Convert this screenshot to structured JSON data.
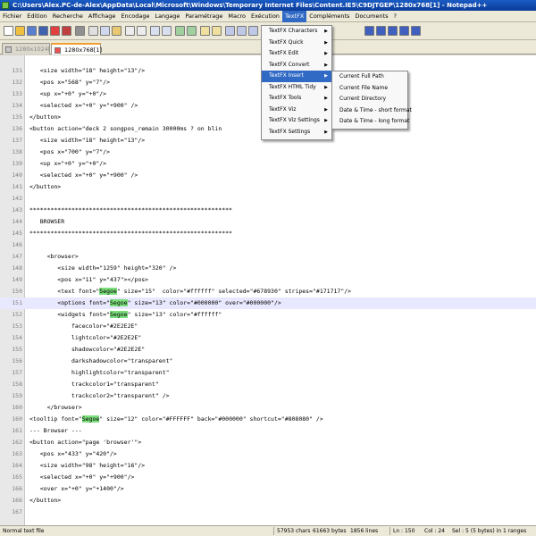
{
  "window": {
    "title": "C:\\Users\\Alex.PC-de-Alex\\AppData\\Local\\Microsoft\\Windows\\Temporary Internet Files\\Content.IE5\\C9DJTGEP\\1280x768[1] - Notepad++"
  },
  "menubar": {
    "items": [
      {
        "label": "Fichier"
      },
      {
        "label": "Edition"
      },
      {
        "label": "Recherche"
      },
      {
        "label": "Affichage"
      },
      {
        "label": "Encodage"
      },
      {
        "label": "Langage"
      },
      {
        "label": "Paramétrage"
      },
      {
        "label": "Macro"
      },
      {
        "label": "Exécution"
      },
      {
        "label": "TextFX"
      },
      {
        "label": "Compléments"
      },
      {
        "label": "Documents"
      },
      {
        "label": "?"
      }
    ]
  },
  "tabs": [
    {
      "label": "1280x1024[1]"
    },
    {
      "label": "1280x768[1]"
    }
  ],
  "editor": {
    "lines": [
      {
        "n": "131",
        "code": "   <size width=\"18\" height=\"13\"/>"
      },
      {
        "n": "132",
        "code": "   <pos x=\"568\" y=\"7\"/>"
      },
      {
        "n": "133",
        "code": "   <up x=\"+0\" y=\"+0\"/>"
      },
      {
        "n": "134",
        "code": "   <selected x=\"+0\" y=\"+900\" />"
      },
      {
        "n": "135",
        "code": "</button>"
      },
      {
        "n": "136",
        "code": "<button action=\"deck 2 songpos_remain 30000ms ? on blin"
      },
      {
        "n": "137",
        "code": "   <size width=\"18\" height=\"13\"/>"
      },
      {
        "n": "138",
        "code": "   <pos x=\"700\" y=\"7\"/>"
      },
      {
        "n": "139",
        "code": "   <up x=\"+0\" y=\"+0\"/>"
      },
      {
        "n": "140",
        "code": "   <selected x=\"+0\" y=\"+900\" />"
      },
      {
        "n": "141",
        "code": "</button>"
      },
      {
        "n": "142",
        "code": ""
      },
      {
        "n": "143",
        "code": "**********************************************************"
      },
      {
        "n": "144",
        "code": "   BROWSER"
      },
      {
        "n": "145",
        "code": "**********************************************************"
      },
      {
        "n": "146",
        "code": ""
      },
      {
        "n": "147",
        "code": "     <browser>"
      },
      {
        "n": "148",
        "code": "        <size width=\"1259\" height=\"320\" />"
      },
      {
        "n": "149",
        "code": "        <pos x=\"11\" y=\"437\"></pos>"
      },
      {
        "n": "150",
        "pre": "        <text font=\"",
        "hl": "Segoe",
        "post": "\" size=\"15\"  color=\"#ffffff\" selected=\"#678930\" stripes=\"#171717\"/>"
      },
      {
        "n": "151",
        "pre": "        <options font=\"",
        "hl": "Segoe",
        "post": "\" size=\"13\" color=\"#000000\" over=\"#000000\"/>"
      },
      {
        "n": "152",
        "pre": "        <widgets font=\"",
        "hl": "Segoe",
        "post": "\" size=\"13\" color=\"#ffffff\""
      },
      {
        "n": "153",
        "code": "            facecolor=\"#2E2E2E\""
      },
      {
        "n": "154",
        "code": "            lightcolor=\"#2E2E2E\""
      },
      {
        "n": "155",
        "code": "            shadowcolor=\"#2E2E2E\""
      },
      {
        "n": "156",
        "code": "            darkshadowcolor=\"transparent\""
      },
      {
        "n": "157",
        "code": "            highlightcolor=\"transparent\""
      },
      {
        "n": "158",
        "code": "            trackcolor1=\"transparent\""
      },
      {
        "n": "159",
        "code": "            trackcolor2=\"transparent\" />"
      },
      {
        "n": "160",
        "code": "     </browser>"
      },
      {
        "n": "160",
        "pre": "<tooltip font=\"",
        "hl": "Segoe",
        "post": "\" size=\"12\" color=\"#FFFFFF\" back=\"#000000\" shortcut=\"#808080\" />"
      },
      {
        "n": "161",
        "code": "--- Browser ---"
      },
      {
        "n": "162",
        "code": "<button action=\"page 'browser'\">"
      },
      {
        "n": "163",
        "code": "   <pos x=\"433\" y=\"420\"/>"
      },
      {
        "n": "164",
        "code": "   <size width=\"98\" height=\"16\"/>"
      },
      {
        "n": "165",
        "code": "   <selected x=\"+0\" y=\"+900\"/>"
      },
      {
        "n": "166",
        "code": "   <over x=\"+0\" y=\"+1400\"/>"
      },
      {
        "n": "166",
        "code": "</button>"
      },
      {
        "n": "167",
        "code": ""
      }
    ]
  },
  "textfx_menu": {
    "items": [
      {
        "label": "TextFX Characters"
      },
      {
        "label": "TextFX Quick"
      },
      {
        "label": "TextFX Edit"
      },
      {
        "label": "TextFX Convert"
      },
      {
        "label": "TextFX Insert"
      },
      {
        "label": "TextFX HTML Tidy"
      },
      {
        "label": "TextFX Tools"
      },
      {
        "label": "TextFX Viz"
      },
      {
        "label": "TextFX Viz Settings"
      },
      {
        "label": "TextFX Settings"
      }
    ]
  },
  "insert_submenu": {
    "items": [
      {
        "label": "Current Full Path"
      },
      {
        "label": "Current File Name"
      },
      {
        "label": "Current Directory"
      },
      {
        "label": "Date & Time - short format"
      },
      {
        "label": "Date & Time - long format"
      }
    ]
  },
  "status": {
    "file_type": "Normal text file",
    "chars": "57953 chars",
    "bytes": "61663 bytes",
    "lines": "1856 lines",
    "ln": "Ln : 150",
    "col": "Col : 24",
    "sel": "Sel : 5 (5 bytes) in 1 ranges"
  },
  "colors": {
    "accent": "#316ac5",
    "title": "#0a3a99",
    "highlight": "#7cde7c"
  }
}
